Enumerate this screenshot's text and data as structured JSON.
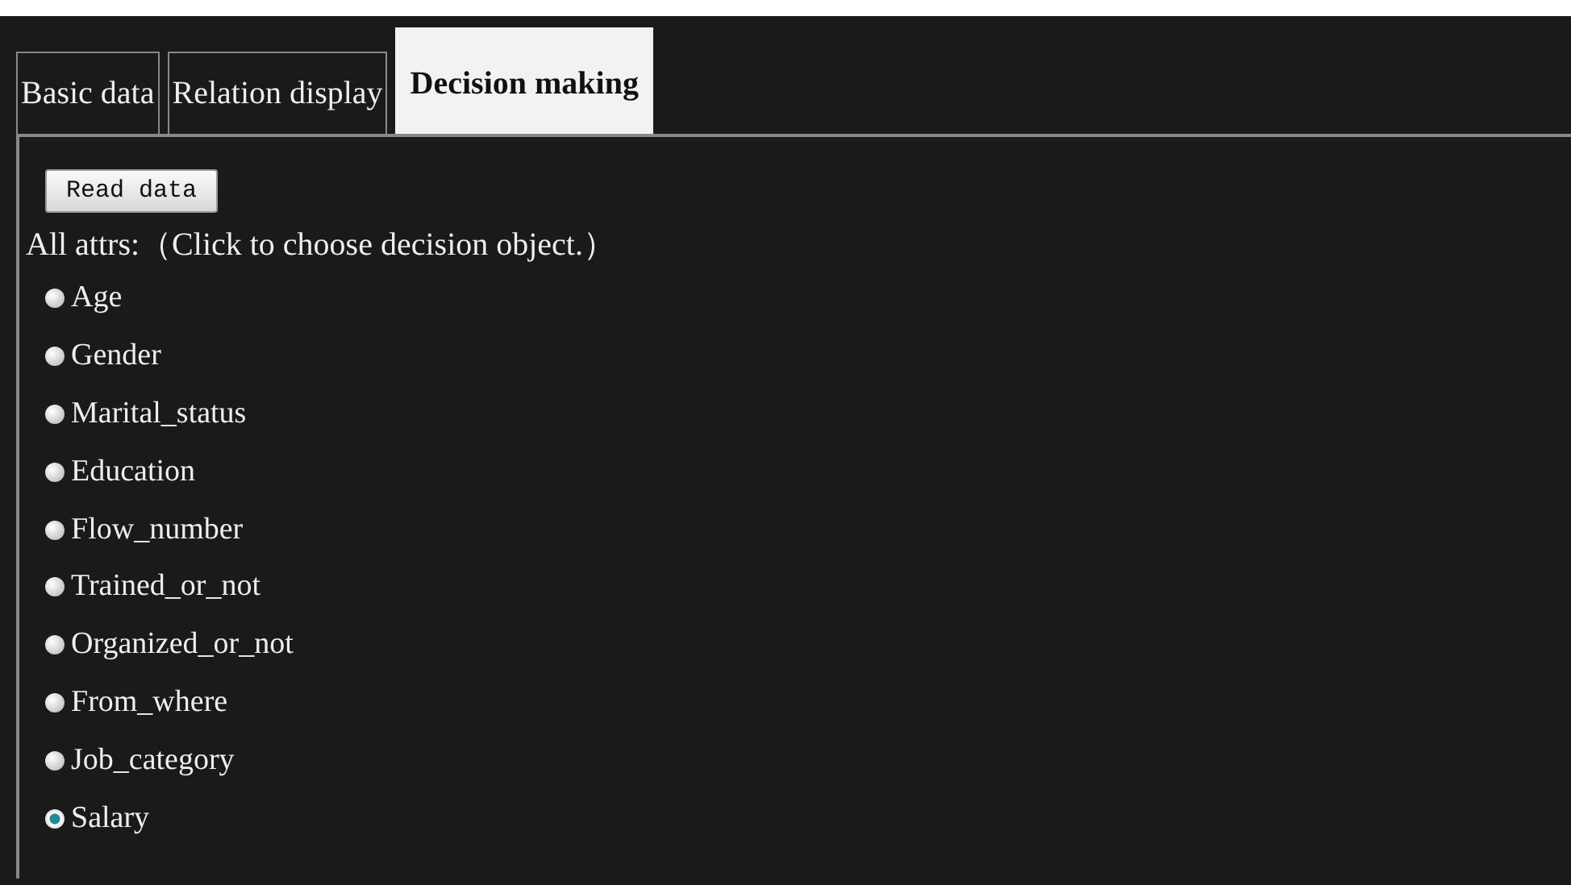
{
  "tabs": [
    {
      "label": "Basic data",
      "selected": false
    },
    {
      "label": "Relation display",
      "selected": false
    },
    {
      "label": "Decision making",
      "selected": true
    }
  ],
  "read_button": "Read data",
  "instruction": "All attrs:（Click to choose decision object.）",
  "attributes": [
    {
      "label": "Age",
      "selected": false
    },
    {
      "label": "Gender",
      "selected": false
    },
    {
      "label": "Marital_status",
      "selected": false
    },
    {
      "label": "Education",
      "selected": false
    },
    {
      "label": "Flow_number",
      "selected": false
    },
    {
      "label": "Trained_or_not",
      "selected": false
    },
    {
      "label": "Organized_or_not",
      "selected": false
    },
    {
      "label": "From_where",
      "selected": false
    },
    {
      "label": "Job_category",
      "selected": false
    },
    {
      "label": "Salary",
      "selected": true
    }
  ]
}
